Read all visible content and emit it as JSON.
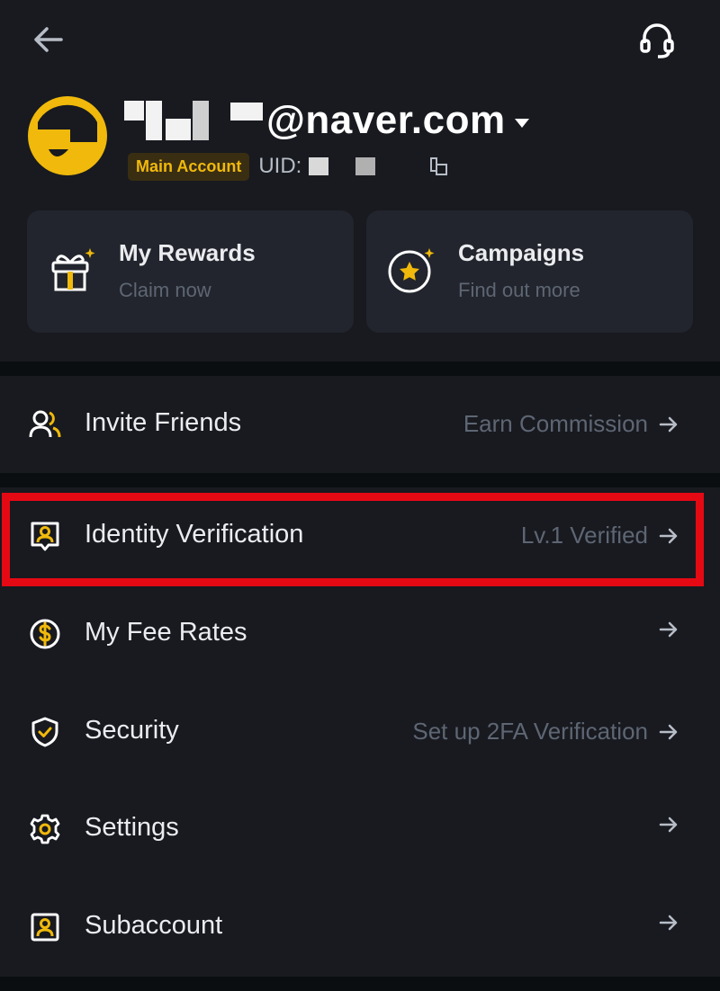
{
  "header": {
    "back_icon": "arrow-left-icon",
    "support_icon": "headset-icon"
  },
  "profile": {
    "email": "@naver.com",
    "badge": "Main Account",
    "uid_label": "UID:",
    "avatar_icon": "avatar-icon",
    "copy_icon": "copy-icon"
  },
  "cards": [
    {
      "title": "My Rewards",
      "subtitle": "Claim now",
      "icon": "gift-icon"
    },
    {
      "title": "Campaigns",
      "subtitle": "Find out more",
      "icon": "star-badge-icon"
    }
  ],
  "menu": [
    {
      "label": "Invite Friends",
      "right": "Earn Commission",
      "icon": "users-icon"
    },
    {
      "label": "Identity Verification",
      "right": "Lv.1 Verified",
      "icon": "id-card-icon"
    },
    {
      "label": "My Fee Rates",
      "right": "",
      "icon": "dollar-circle-icon"
    },
    {
      "label": "Security",
      "right": "Set up 2FA Verification",
      "icon": "shield-check-icon"
    },
    {
      "label": "Settings",
      "right": "",
      "icon": "gear-icon"
    },
    {
      "label": "Subaccount",
      "right": "",
      "icon": "user-square-icon"
    }
  ],
  "colors": {
    "background": "#181a20",
    "accent": "#f0b90b",
    "highlight": "#e50914"
  }
}
